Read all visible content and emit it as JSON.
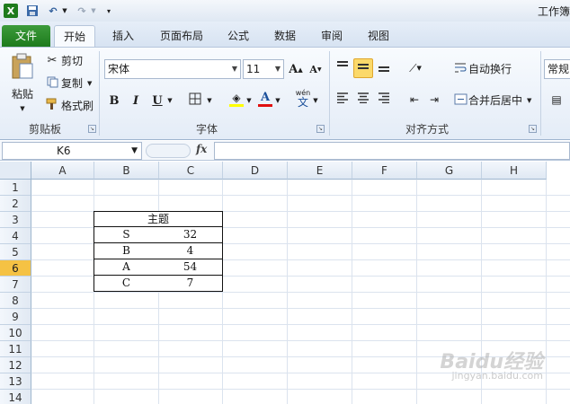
{
  "title_bar": {
    "window_title": "工作簿",
    "quick_access": [
      "excel-logo-icon",
      "save-icon",
      "undo-icon",
      "redo-icon",
      "customize-icon"
    ]
  },
  "tabs": [
    {
      "label": "文件"
    },
    {
      "label": "开始"
    },
    {
      "label": "插入"
    },
    {
      "label": "页面布局"
    },
    {
      "label": "公式"
    },
    {
      "label": "数据"
    },
    {
      "label": "审阅"
    },
    {
      "label": "视图"
    }
  ],
  "ribbon": {
    "clipboard": {
      "paste": "粘贴",
      "cut": "剪切",
      "copy": "复制",
      "format_painter": "格式刷",
      "group_label": "剪贴板"
    },
    "font": {
      "font_name": "宋体",
      "font_size": "11",
      "group_label": "字体",
      "bold": "B",
      "italic": "I",
      "underline": "U",
      "grow": "A",
      "shrink": "A",
      "font_color": "A",
      "phonetic": "wén"
    },
    "alignment": {
      "wrap_text": "自动换行",
      "merge_center": "合并后居中",
      "group_label": "对齐方式"
    },
    "number": {
      "format": "常规"
    }
  },
  "formula_bar": {
    "name_box": "K6",
    "fx": "fx",
    "formula": ""
  },
  "grid": {
    "columns": [
      "A",
      "B",
      "C",
      "D",
      "E",
      "F",
      "G",
      "H"
    ],
    "rows": [
      "1",
      "2",
      "3",
      "4",
      "5",
      "6",
      "7",
      "8",
      "9",
      "10",
      "11",
      "12",
      "13",
      "14"
    ],
    "active_row": "6",
    "table": {
      "header": "主题",
      "rows": [
        {
          "label": "S",
          "value": "32"
        },
        {
          "label": "B",
          "value": "4"
        },
        {
          "label": "A",
          "value": "54"
        },
        {
          "label": "C",
          "value": "7"
        }
      ]
    }
  },
  "watermark": {
    "text": "Baidu经验",
    "sub": "jingyan.baidu.com"
  },
  "colors": {
    "file_tab": "#2a8a29",
    "active_row_header": "#f5c244",
    "ribbon_bg": "#e4ecf7"
  }
}
